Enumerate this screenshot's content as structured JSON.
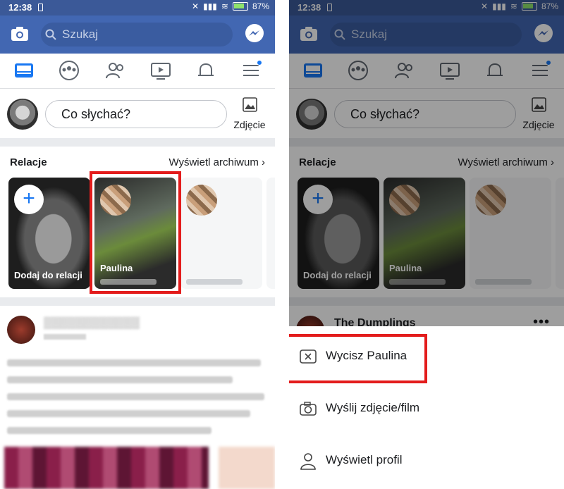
{
  "status_bar": {
    "time": "12:38",
    "battery": "87%"
  },
  "search": {
    "placeholder": "Szukaj"
  },
  "composer": {
    "prompt": "Co słychać?",
    "photo_label": "Zdjęcie"
  },
  "stories": {
    "title": "Relacje",
    "archive_label": "Wyświetl archiwum",
    "cards": [
      {
        "label": "Dodaj do relacji"
      },
      {
        "label": "Paulina"
      }
    ]
  },
  "post": {
    "page_name": "The Dumplings"
  },
  "sheet": {
    "items": [
      {
        "label": "Wycisz Paulina",
        "icon": "close-box-icon"
      },
      {
        "label": "Wyślij zdjęcie/film",
        "icon": "camera-icon"
      },
      {
        "label": "Wyświetl profil",
        "icon": "person-icon"
      }
    ]
  },
  "colors": {
    "brand": "#4267b2",
    "status": "#3b5998",
    "highlight": "#e31c1c",
    "accent": "#1877f2"
  }
}
